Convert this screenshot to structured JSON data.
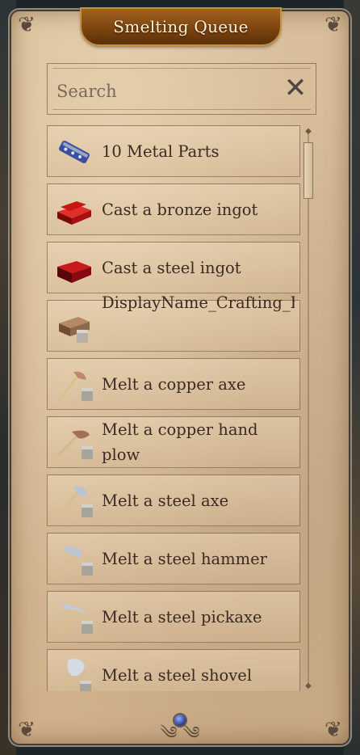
{
  "window": {
    "title": "Smelting Queue"
  },
  "search": {
    "placeholder": "Search",
    "value": ""
  },
  "icons": {
    "clear": "close-x-icon"
  },
  "items": [
    {
      "label": "10 Metal Parts",
      "icon": "metal-parts-icon",
      "colors": [
        "#3c4ea2",
        "#9aa7c4"
      ]
    },
    {
      "label": "Cast a bronze ingot",
      "icon": "bronze-ingot-icon",
      "colors": [
        "#c71712",
        "#7a0a08"
      ]
    },
    {
      "label": "Cast a steel ingot",
      "icon": "steel-ingot-icon",
      "colors": [
        "#a90f14",
        "#5a060a"
      ]
    },
    {
      "label": "DisplayName_Crafting_BronzeIngotFromParts",
      "icon": "bronze-parts-icon",
      "colors": [
        "#8a6a4a",
        "#b5b0a8"
      ]
    },
    {
      "label": "Melt a copper axe",
      "icon": "copper-axe-icon",
      "colors": [
        "#c08a6a",
        "#a7a39d"
      ]
    },
    {
      "label": "Melt a copper hand plow",
      "icon": "copper-plow-icon",
      "colors": [
        "#a46f55",
        "#a7a39d"
      ]
    },
    {
      "label": "Melt a steel axe",
      "icon": "steel-axe-icon",
      "colors": [
        "#b9c3d2",
        "#a7a39d"
      ]
    },
    {
      "label": "Melt a steel hammer",
      "icon": "steel-hammer-icon",
      "colors": [
        "#bcc5d2",
        "#a7a39d"
      ]
    },
    {
      "label": "Melt a steel pickaxe",
      "icon": "steel-pickaxe-icon",
      "colors": [
        "#c3cad6",
        "#a7a39d"
      ]
    },
    {
      "label": "Melt a steel shovel",
      "icon": "steel-shovel-icon",
      "colors": [
        "#d5dbe4",
        "#a7a39d"
      ]
    }
  ],
  "theme": {
    "parchment": "#d5b996",
    "title_bar": "#7e4510",
    "text": "#3a2a1f"
  }
}
